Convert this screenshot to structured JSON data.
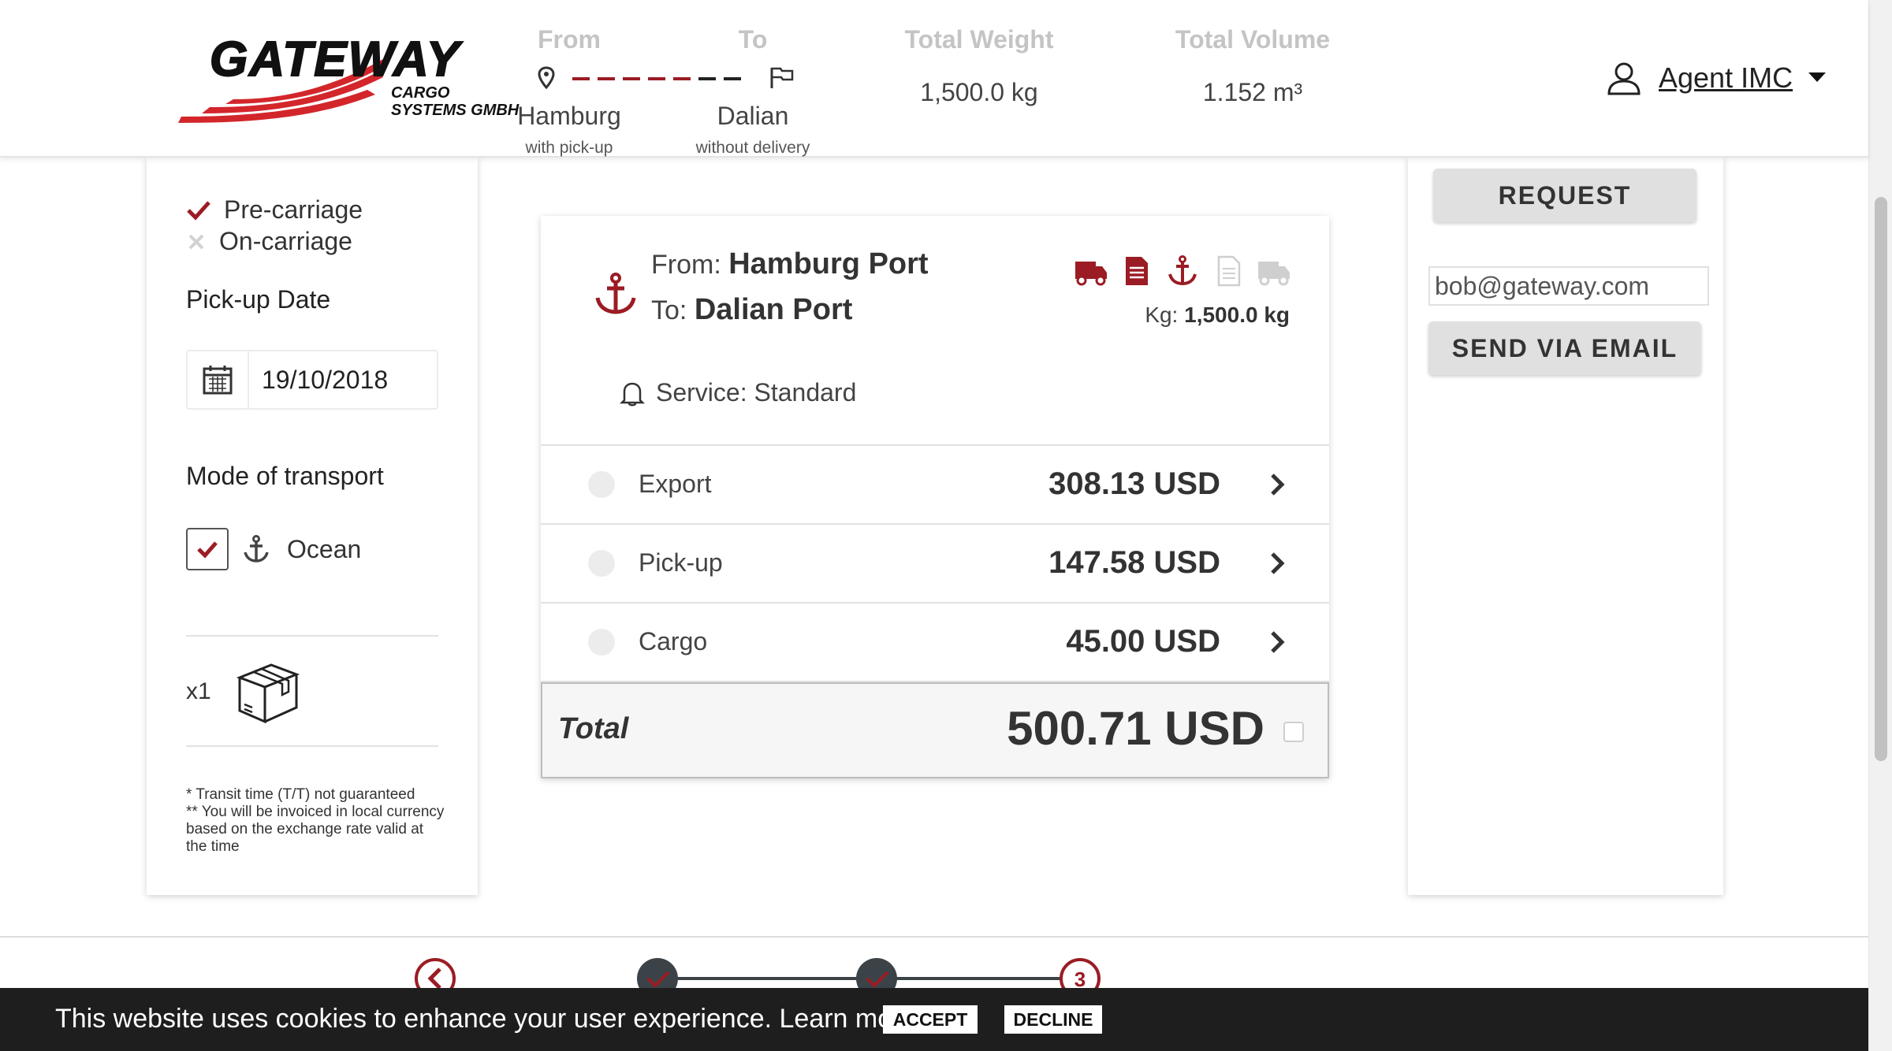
{
  "brand": {
    "logo_word": "GATEWAY",
    "logo_sub1": "CARGO",
    "logo_sub2": "SYSTEMS GMBH"
  },
  "header": {
    "from": {
      "label": "From",
      "city": "Hamburg",
      "note": "with pick-up"
    },
    "to": {
      "label": "To",
      "city": "Dalian",
      "note": "without delivery"
    },
    "weight": {
      "label": "Total Weight",
      "value": "1,500.0 kg"
    },
    "volume": {
      "label": "Total Volume",
      "value": "1.152 m³"
    },
    "agent": "Agent IMC"
  },
  "sidebar": {
    "precarriage": "Pre-carriage",
    "oncarriage": "On-carriage",
    "pickup_date_label": "Pick-up Date",
    "pickup_date": "19/10/2018",
    "mode_label": "Mode of transport",
    "mode_ocean": "Ocean",
    "package_count": "x1",
    "notes": [
      "* Transit time (T/T) not guaranteed",
      "** You will be invoiced in local currency based on the exchange rate valid at the time"
    ]
  },
  "quote": {
    "from_prefix": "From:",
    "from_port": "Hamburg Port",
    "to_prefix": "To:",
    "to_port": "Dalian Port",
    "kg_prefix": "Kg:",
    "kg_value": "1,500.0 kg",
    "service": "Service: Standard",
    "mode_icons": [
      "truck-icon",
      "document-icon",
      "anchor-icon",
      "document-outline-icon",
      "truck-outline-icon"
    ],
    "rows": [
      {
        "label": "Export",
        "amount": "308.13 USD"
      },
      {
        "label": "Pick-up",
        "amount": "147.58 USD"
      },
      {
        "label": "Cargo",
        "amount": "45.00 USD"
      }
    ],
    "total_label": "Total",
    "total_amount": "500.71 USD"
  },
  "actions": {
    "request": "REQUEST",
    "email": "bob@gateway.com",
    "send_email": "SEND VIA EMAIL"
  },
  "stepper": {
    "current_step": "3"
  },
  "cookie": {
    "text": "This website uses cookies to enhance your user experience. Learn more",
    "accept": "ACCEPT",
    "decline": "DECLINE"
  },
  "colors": {
    "accent": "#9b1c24",
    "logo_red": "#d3262b",
    "step_dark": "#3b4348"
  }
}
